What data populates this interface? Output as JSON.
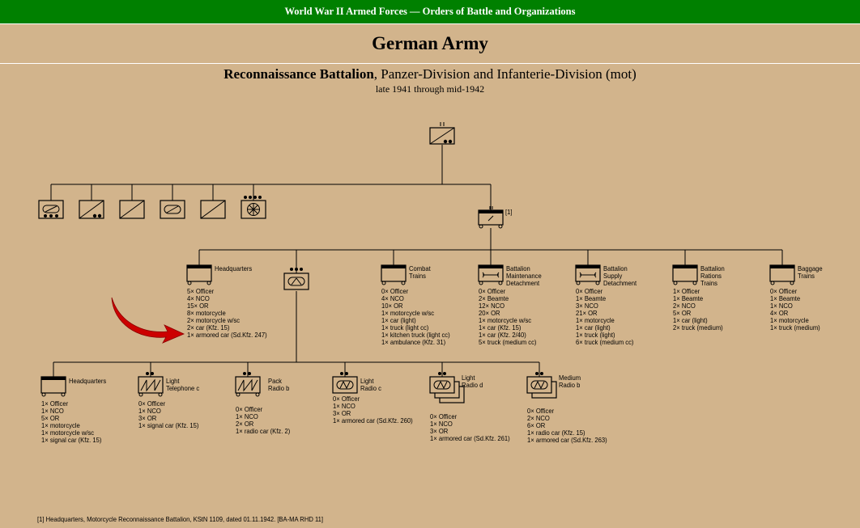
{
  "banner": "World War II Armed Forces — Orders of Battle and Organizations",
  "title": "German Army",
  "subtitle_bold": "Reconnaissance Battalion",
  "subtitle_rest": ", Panzer-Division and Infanterie-Division (mot)",
  "period": "late 1941 through mid-1942",
  "trains_footnote_ref": "[1]",
  "footnote": "[1] Headquarters, Motorcycle Reconnaissance Battalion, KStN 1109, dated 01.11.1942. [BA-MA RHD 11]",
  "colors": {
    "banner": "#008000",
    "background": "#d2b48c",
    "arrow": "#cc0000"
  },
  "units_row2": [
    {
      "name": "Headquarters",
      "lines": [
        "5× Officer",
        "4× NCO",
        "15× OR",
        "8× motorcycle",
        "2× motorcycle w/sc",
        "2× car (Kfz. 15)",
        "1× armored car (Sd.Kfz. 247)"
      ]
    },
    {
      "name": "Combat\nTrains",
      "lines": [
        "0× Officer",
        "4× NCO",
        "10× OR",
        "1× motorcycle w/sc",
        "1× car (light)",
        "1× truck (light cc)",
        "1× kitchen truck (light cc)",
        "1× ambulance (Kfz. 31)"
      ]
    },
    {
      "name": "Battalion\nMaintenance\nDetachment",
      "lines": [
        "0× Officer",
        "2× Beamte",
        "12× NCO",
        "20× OR",
        "1× motorcycle w/sc",
        "1× car (Kfz. 15)",
        "1× car (Kfz. 2/40)",
        "5× truck (medium cc)"
      ]
    },
    {
      "name": "Battalion\nSupply\nDetachment",
      "lines": [
        "0× Officer",
        "1× Beamte",
        "3× NCO",
        "21× OR",
        "1× motorcycle",
        "1× car (light)",
        "1× truck (light)",
        "6× truck (medium cc)"
      ]
    },
    {
      "name": "Battalion\nRations\nTrains",
      "lines": [
        "1× Officer",
        "1× Beamte",
        "2× NCO",
        "5× OR",
        "1× car (light)",
        "2× truck (medium)"
      ]
    },
    {
      "name": "Baggage\nTrains",
      "lines": [
        "0× Officer",
        "1× Beamte",
        "1× NCO",
        "4× OR",
        "1× motorcycle",
        "1× truck (medium)"
      ]
    }
  ],
  "units_row3": [
    {
      "name": "Headquarters",
      "lines": [
        "1× Officer",
        "1× NCO",
        "5× OR",
        "1× motorcycle",
        "1× motorcycle w/sc",
        "1× signal car (Kfz. 15)"
      ]
    },
    {
      "name": "Light\nTelephone c",
      "lines": [
        "0× Officer",
        "1× NCO",
        "3× OR",
        "1× signal car (Kfz. 15)"
      ]
    },
    {
      "name": "Pack\nRadio b",
      "lines": [
        "0× Officer",
        "1× NCO",
        "2× OR",
        "1× radio car (Kfz. 2)"
      ]
    },
    {
      "name": "Light\nRadio c",
      "lines": [
        "0× Officer",
        "1× NCO",
        "3× OR",
        "1× armored car (Sd.Kfz. 260)"
      ]
    },
    {
      "name": "Light\nRadio d",
      "lines": [
        "0× Officer",
        "1× NCO",
        "3× OR",
        "1× armored car (Sd.Kfz. 261)"
      ]
    },
    {
      "name": "Medium\nRadio b",
      "lines": [
        "0× Officer",
        "2× NCO",
        "6× OR",
        "1× radio car (Kfz. 15)",
        "1× armored car (Sd.Kfz. 263)"
      ]
    }
  ]
}
